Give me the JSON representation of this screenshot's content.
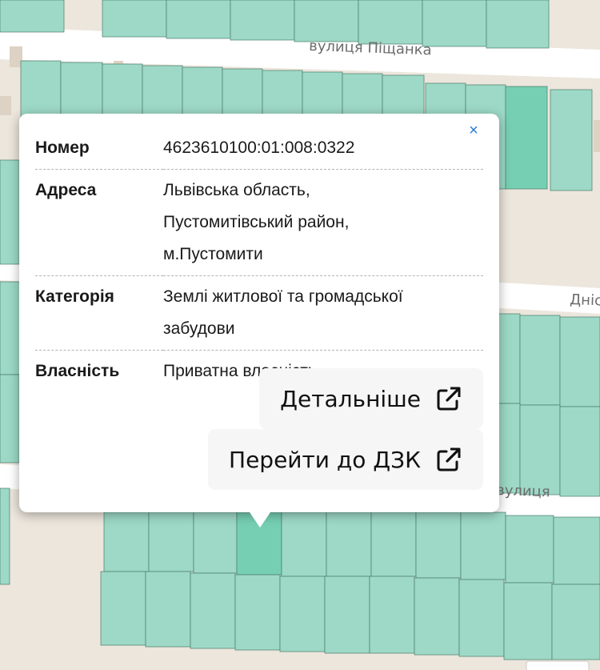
{
  "map": {
    "streets": [
      "вулиця Піщанка",
      "Дніс",
      "вулиця"
    ],
    "colors": {
      "parcel": "#9dd9c6",
      "parcel_selected": "#76cfb3",
      "road": "#ffffff",
      "ground": "#ece6dc",
      "building": "#d9cfc2"
    }
  },
  "popup": {
    "close_label": "×",
    "rows": [
      {
        "key": "Номер",
        "value_lines": [
          "4623610100:01:008:0322"
        ]
      },
      {
        "key": "Адреса",
        "value_lines": [
          "Львівська область,",
          "Пустомитівський район,",
          "м.Пустомити"
        ]
      },
      {
        "key": "Категорія",
        "value_lines": [
          "Землі житлової та громадської",
          "забудови"
        ]
      },
      {
        "key": "Власність",
        "value_lines": [
          "Приватна власність"
        ]
      }
    ],
    "buttons": [
      {
        "label": "Детальніше",
        "icon": "external-link-icon"
      },
      {
        "label": "Перейти до ДЗК",
        "icon": "external-link-icon"
      }
    ]
  }
}
